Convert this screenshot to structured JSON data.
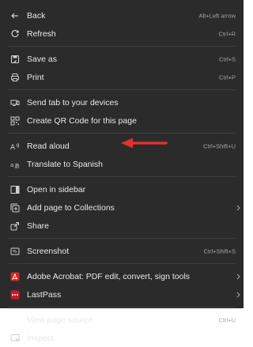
{
  "menu": {
    "items": [
      {
        "label": "Back",
        "shortcut": "Alt+Left arrow",
        "icon": "back-arrow-icon"
      },
      {
        "label": "Refresh",
        "shortcut": "Ctrl+R",
        "icon": "refresh-icon"
      },
      {
        "label": "Save as",
        "shortcut": "Ctrl+S",
        "icon": "save-as-icon"
      },
      {
        "label": "Print",
        "shortcut": "Ctrl+P",
        "icon": "print-icon"
      },
      {
        "label": "Send tab to your devices",
        "shortcut": "",
        "icon": "send-tab-icon"
      },
      {
        "label": "Create QR Code for this page",
        "shortcut": "",
        "icon": "qr-code-icon"
      },
      {
        "label": "Read aloud",
        "shortcut": "Ctrl+Shift+U",
        "icon": "read-aloud-icon"
      },
      {
        "label": "Translate to Spanish",
        "shortcut": "",
        "icon": "translate-icon"
      },
      {
        "label": "Open in sidebar",
        "shortcut": "",
        "icon": "sidebar-icon"
      },
      {
        "label": "Add page to Collections",
        "shortcut": "",
        "icon": "collections-icon"
      },
      {
        "label": "Share",
        "shortcut": "",
        "icon": "share-icon"
      },
      {
        "label": "Screenshot",
        "shortcut": "Ctrl+Shift+S",
        "icon": "screenshot-icon"
      },
      {
        "label": "Adobe Acrobat: PDF edit, convert, sign tools",
        "shortcut": "",
        "icon": "adobe-acrobat-icon"
      },
      {
        "label": "LastPass",
        "shortcut": "",
        "icon": "lastpass-icon"
      },
      {
        "label": "View page source",
        "shortcut": "Ctrl+U",
        "icon": ""
      },
      {
        "label": "Inspect",
        "shortcut": "",
        "icon": "inspect-icon"
      }
    ]
  },
  "colors": {
    "menu_background": "#2b2b2b",
    "text": "#e8e8e8",
    "shortcut_text": "#a6a6a6",
    "annotation_arrow": "#e03131",
    "acrobat_red": "#d8261d",
    "lastpass_red": "#c9182b"
  }
}
